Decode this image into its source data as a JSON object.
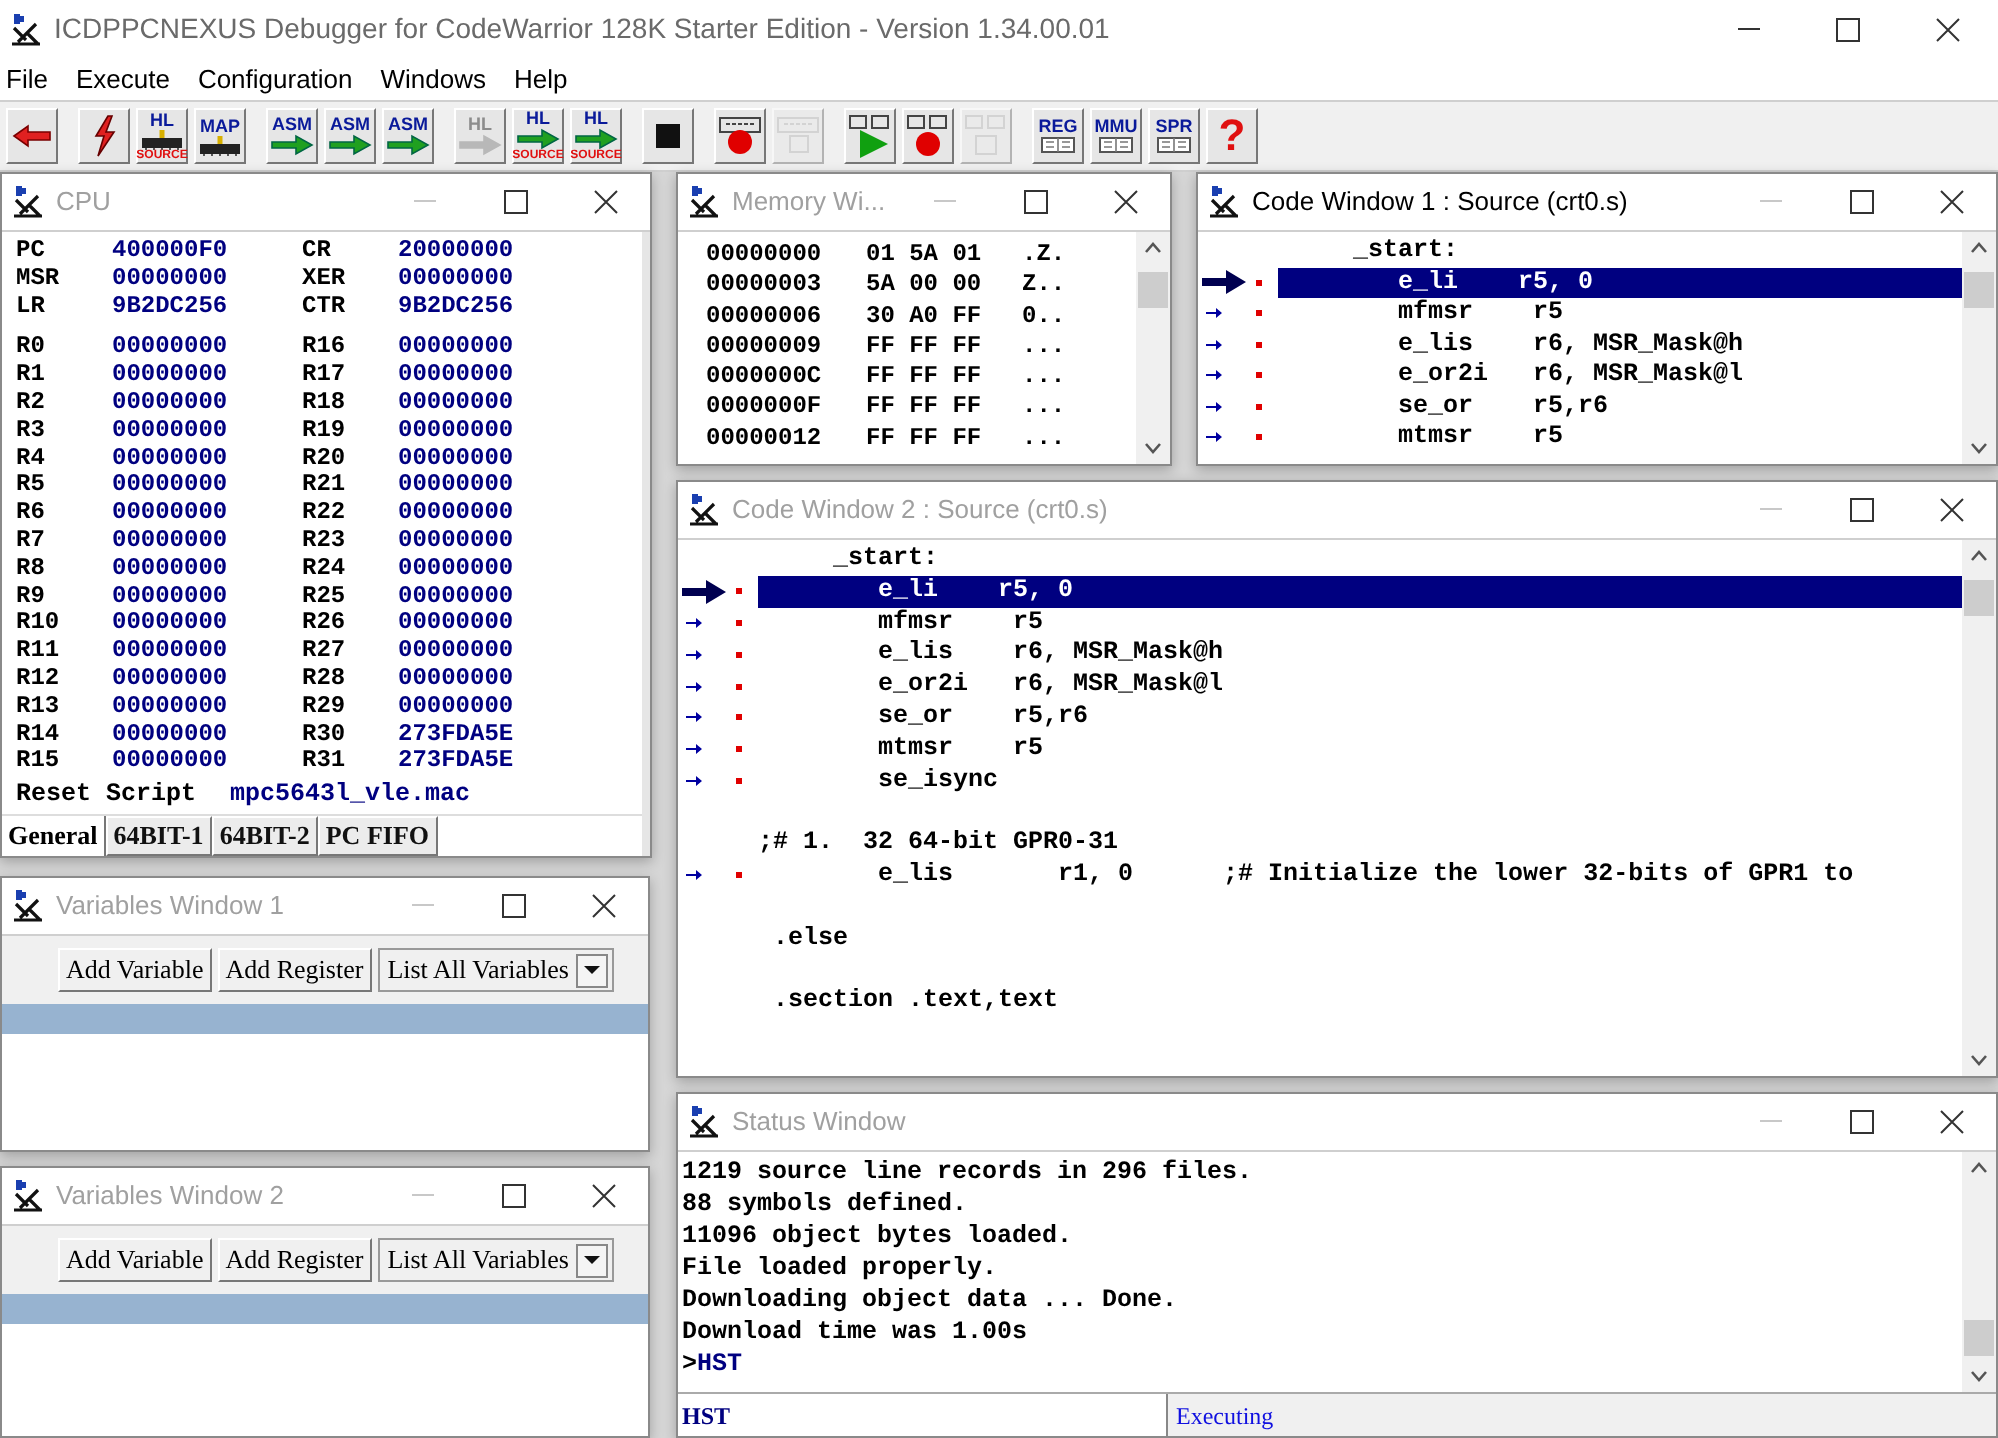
{
  "app": {
    "title": "ICDPPCNEXUS Debugger for CodeWarrior 128K Starter Edition - Version 1.34.00.01"
  },
  "menu": [
    "File",
    "Execute",
    "Configuration",
    "Windows",
    "Help"
  ],
  "toolbar": [
    [
      {
        "kind": "back",
        "disabled": false
      }
    ],
    [
      {
        "kind": "flash",
        "disabled": false
      },
      {
        "kind": "load",
        "label": "HL",
        "sub": "SOURCE",
        "disabled": false
      },
      {
        "kind": "load",
        "label": "MAP",
        "disabled": false
      }
    ],
    [
      {
        "kind": "step",
        "label": "ASM",
        "disabled": false
      },
      {
        "kind": "step",
        "label": "ASM",
        "disabled": false
      },
      {
        "kind": "step",
        "label": "ASM",
        "disabled": false
      }
    ],
    [
      {
        "kind": "step",
        "label": "HL",
        "disabled": true
      },
      {
        "kind": "step",
        "label": "HL",
        "sub": "SOURCE",
        "disabled": false
      },
      {
        "kind": "step",
        "label": "HL",
        "sub": "SOURCE",
        "disabled": false
      }
    ],
    [
      {
        "kind": "stop",
        "disabled": false
      }
    ],
    [
      {
        "kind": "breakpoint",
        "disabled": false
      },
      {
        "kind": "breakpoint",
        "disabled": true
      }
    ],
    [
      {
        "kind": "go",
        "disabled": false
      },
      {
        "kind": "monitor_breakpoint",
        "disabled": false
      },
      {
        "kind": "monitor_breakpoint",
        "disabled": true
      }
    ],
    [
      {
        "kind": "window",
        "label": "REG",
        "disabled": false
      },
      {
        "kind": "window",
        "label": "MMU",
        "disabled": false
      },
      {
        "kind": "window",
        "label": "SPR",
        "disabled": false
      },
      {
        "kind": "help",
        "label": "?",
        "disabled": false
      }
    ]
  ],
  "cpu": {
    "title": "CPU",
    "active": false,
    "special_registers": [
      [
        "PC",
        "400000F0",
        "CR",
        "20000000"
      ],
      [
        "MSR",
        "00000000",
        "XER",
        "00000000"
      ],
      [
        "LR",
        "9B2DC256",
        "CTR",
        "9B2DC256"
      ]
    ],
    "registers": [
      [
        "R0",
        "00000000",
        "R16",
        "00000000"
      ],
      [
        "R1",
        "00000000",
        "R17",
        "00000000"
      ],
      [
        "R2",
        "00000000",
        "R18",
        "00000000"
      ],
      [
        "R3",
        "00000000",
        "R19",
        "00000000"
      ],
      [
        "R4",
        "00000000",
        "R20",
        "00000000"
      ],
      [
        "R5",
        "00000000",
        "R21",
        "00000000"
      ],
      [
        "R6",
        "00000000",
        "R22",
        "00000000"
      ],
      [
        "R7",
        "00000000",
        "R23",
        "00000000"
      ],
      [
        "R8",
        "00000000",
        "R24",
        "00000000"
      ],
      [
        "R9",
        "00000000",
        "R25",
        "00000000"
      ],
      [
        "R10",
        "00000000",
        "R26",
        "00000000"
      ],
      [
        "R11",
        "00000000",
        "R27",
        "00000000"
      ],
      [
        "R12",
        "00000000",
        "R28",
        "00000000"
      ],
      [
        "R13",
        "00000000",
        "R29",
        "00000000"
      ],
      [
        "R14",
        "00000000",
        "R30",
        "273FDA5E"
      ],
      [
        "R15",
        "00000000",
        "R31",
        "273FDA5E"
      ]
    ],
    "reset_script": {
      "label": "Reset Script",
      "value": "mpc5643l_vle.mac"
    },
    "tabs": [
      {
        "label": "General",
        "selected": true
      },
      {
        "label": "64BIT-1",
        "selected": false
      },
      {
        "label": "64BIT-2",
        "selected": false
      },
      {
        "label": "PC FIFO",
        "selected": false
      }
    ]
  },
  "memory_window": {
    "title": "Memory Wi...",
    "active": false,
    "rows": [
      [
        "00000000",
        "01 5A 01",
        ".Z."
      ],
      [
        "00000003",
        "5A 00 00",
        "Z.."
      ],
      [
        "00000006",
        "30 A0 FF",
        "0.."
      ],
      [
        "00000009",
        "FF FF FF",
        "..."
      ],
      [
        "0000000C",
        "FF FF FF",
        "..."
      ],
      [
        "0000000F",
        "FF FF FF",
        "..."
      ],
      [
        "00000012",
        "FF FF FF",
        "..."
      ]
    ]
  },
  "code_window_1": {
    "title": "Code Window 1 : Source (crt0.s)",
    "active": true,
    "lines": [
      {
        "kind": "label",
        "text": "     _start:",
        "selected": false
      },
      {
        "kind": "code",
        "text": "        e_li    r5, 0",
        "selected": true
      },
      {
        "kind": "code",
        "text": "        mfmsr    r5",
        "selected": false
      },
      {
        "kind": "code",
        "text": "        e_lis    r6, MSR_Mask@h",
        "selected": false
      },
      {
        "kind": "code",
        "text": "        e_or2i   r6, MSR_Mask@l",
        "selected": false
      },
      {
        "kind": "code",
        "text": "        se_or    r5,r6",
        "selected": false
      },
      {
        "kind": "code",
        "text": "        mtmsr    r5",
        "selected": false
      }
    ]
  },
  "code_window_2": {
    "title": "Code Window 2 : Source (crt0.s)",
    "active": false,
    "lines": [
      {
        "kind": "label",
        "text": "     _start:",
        "selected": false
      },
      {
        "kind": "code",
        "text": "        e_li    r5, 0",
        "selected": true
      },
      {
        "kind": "code",
        "text": "        mfmsr    r5",
        "selected": false
      },
      {
        "kind": "code",
        "text": "        e_lis    r6, MSR_Mask@h",
        "selected": false
      },
      {
        "kind": "code",
        "text": "        e_or2i   r6, MSR_Mask@l",
        "selected": false
      },
      {
        "kind": "code",
        "text": "        se_or    r5,r6",
        "selected": false
      },
      {
        "kind": "code",
        "text": "        mtmsr    r5",
        "selected": false
      },
      {
        "kind": "code",
        "text": "        se_isync",
        "selected": false
      },
      {
        "kind": "blank",
        "selected": false
      },
      {
        "kind": "label",
        "text": ";# 1.  32 64-bit GPR0-31",
        "selected": false
      },
      {
        "kind": "code",
        "text": "        e_lis       r1, 0      ;# Initialize the lower 32-bits of GPR1 to",
        "selected": false
      },
      {
        "kind": "blank",
        "selected": false
      },
      {
        "kind": "label",
        "text": " .else",
        "selected": false
      },
      {
        "kind": "blank",
        "selected": false
      },
      {
        "kind": "label",
        "text": " .section .text,text",
        "selected": false
      }
    ]
  },
  "variables_windows": [
    {
      "title": "Variables Window 1",
      "active": false,
      "buttons": [
        "Add Variable",
        "Add Register"
      ],
      "dropdown": "List All Variables"
    },
    {
      "title": "Variables Window 2",
      "active": false,
      "buttons": [
        "Add Variable",
        "Add Register"
      ],
      "dropdown": "List All Variables"
    }
  ],
  "status_window": {
    "title": "Status Window",
    "active": false,
    "lines": [
      "1219 source line records in 296 files.",
      "88 symbols defined.",
      "11096 object bytes loaded.",
      "File loaded properly.",
      "Downloading object data ... Done.",
      "Download time was 1.00s"
    ],
    "prompt": ">",
    "command": "HST",
    "input": "HST",
    "state": "Executing"
  }
}
